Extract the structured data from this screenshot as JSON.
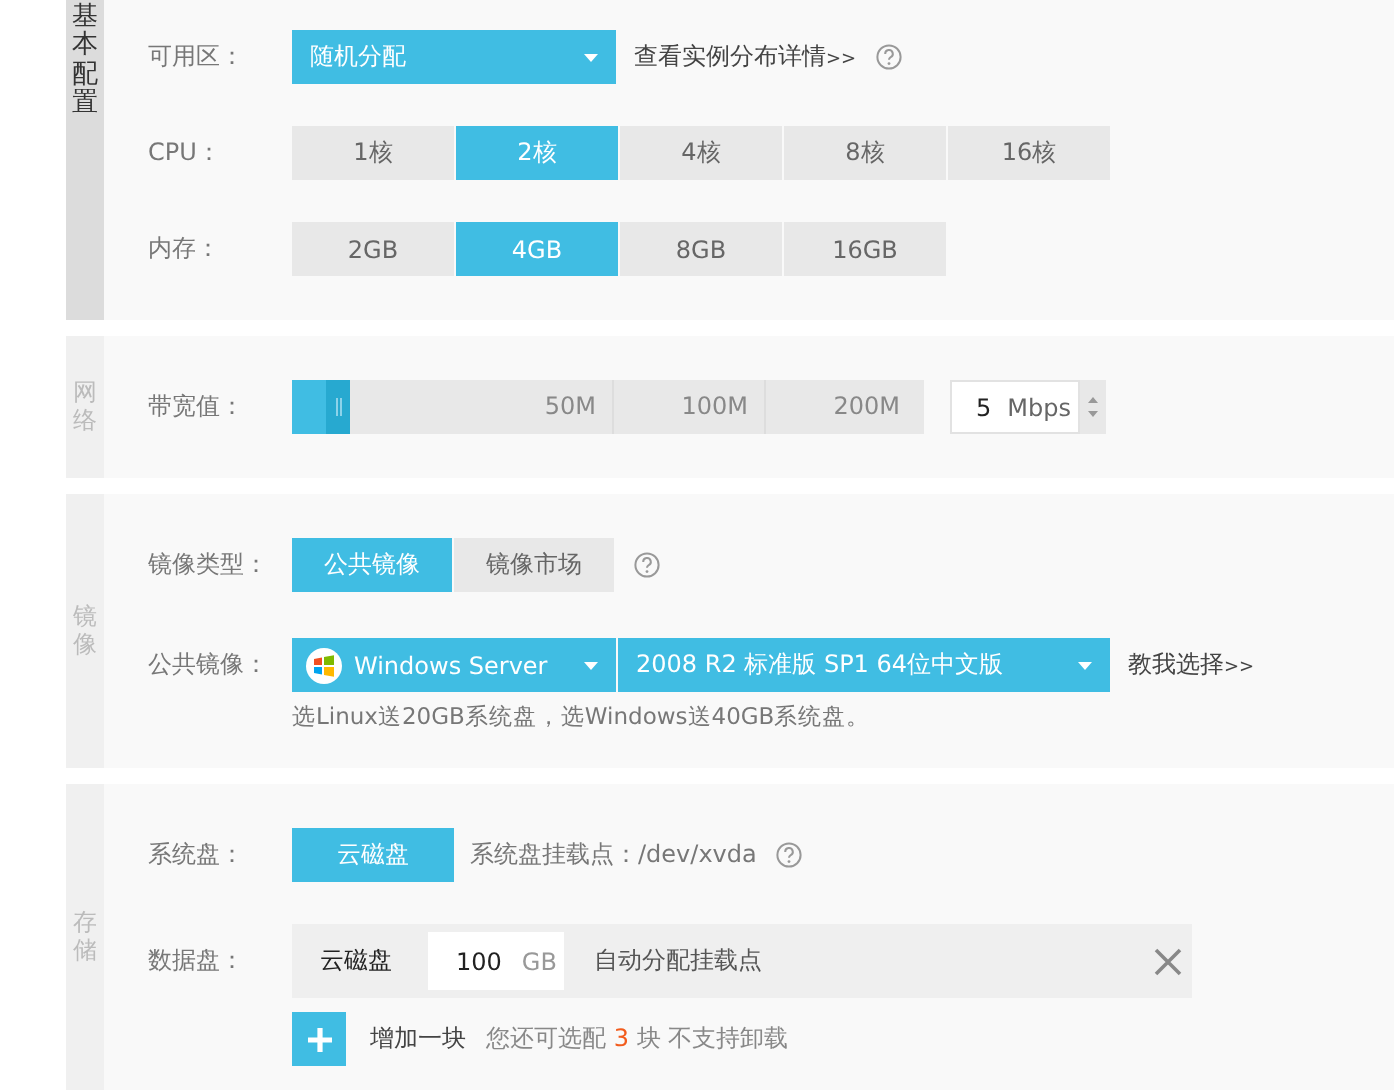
{
  "sections": [
    {
      "kind": "basic",
      "title": "基本配置",
      "dark": true,
      "zone": {
        "label": "可用区：",
        "value": "随机分配",
        "link": "查看实例分布详情",
        "link_arrow": ">>"
      },
      "cpu": {
        "label": "CPU：",
        "options": [
          {
            "label": "1核",
            "selected": false
          },
          {
            "label": "2核",
            "selected": true
          },
          {
            "label": "4核",
            "selected": false
          },
          {
            "label": "8核",
            "selected": false
          },
          {
            "label": "16核",
            "selected": false
          }
        ]
      },
      "memory": {
        "label": "内存：",
        "options": [
          {
            "label": "2GB",
            "selected": false
          },
          {
            "label": "4GB",
            "selected": true
          },
          {
            "label": "8GB",
            "selected": false
          },
          {
            "label": "16GB",
            "selected": false
          }
        ]
      }
    },
    {
      "kind": "network",
      "title": "网络",
      "dark": false,
      "bandwidth": {
        "label": "带宽值：",
        "level": 0.08,
        "marks": [
          "50M",
          "100M",
          "200M"
        ],
        "value": "5",
        "unit": "Mbps"
      }
    },
    {
      "kind": "image",
      "title": "镜像",
      "dark": false,
      "image_type": {
        "label": "镜像类型：",
        "options": [
          {
            "label": "公共镜像",
            "selected": true
          },
          {
            "label": "镜像市场",
            "selected": false
          }
        ]
      },
      "public_image": {
        "label": "公共镜像：",
        "os": "Windows Server",
        "version": "2008 R2 标准版 SP1 64位中文版",
        "link": "教我选择",
        "link_arrow": ">>",
        "hint": "选Linux送20GB系统盘，选Windows送40GB系统盘。"
      }
    },
    {
      "kind": "storage",
      "title": "存储",
      "dark": false,
      "system_disk": {
        "label": "系统盘：",
        "type": "云磁盘",
        "mount": "系统盘挂载点：/dev/xvda"
      },
      "data_disk": {
        "label": "数据盘：",
        "type": "云磁盘",
        "size": "100",
        "unit": "GB",
        "mount": "自动分配挂载点"
      },
      "add": {
        "label": "增加一块",
        "note_before": "您还可选配",
        "count": "3",
        "note_after": "块 不支持卸载"
      }
    }
  ]
}
